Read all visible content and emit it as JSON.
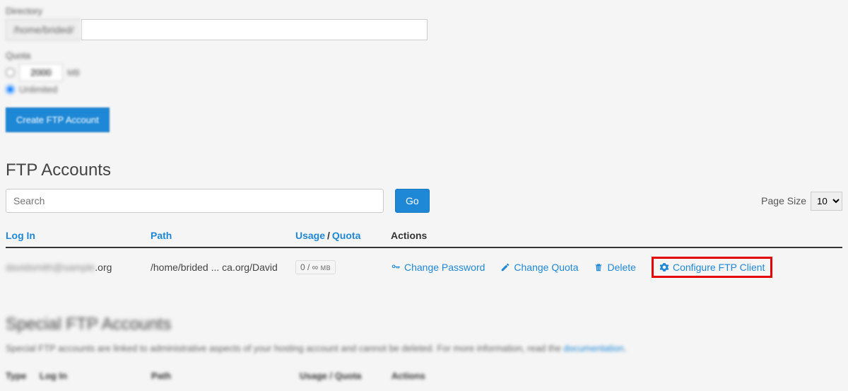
{
  "form": {
    "directory_label": "Directory",
    "directory_prefix": "/home/brided/",
    "quota_label": "Quota",
    "quota_value": "2000",
    "quota_unit": "MB",
    "quota_unlimited": "Unlimited",
    "create_button": "Create FTP Account"
  },
  "ftp_accounts": {
    "title": "FTP Accounts",
    "search_placeholder": "Search",
    "go_button": "Go",
    "page_size_label": "Page Size",
    "page_size_value": "10",
    "headers": {
      "login": "Log In",
      "path": "Path",
      "usage": "Usage",
      "quota": "Quota",
      "actions": "Actions"
    },
    "rows": [
      {
        "login_hidden": "davidsmith@sample",
        "login_visible": ".org",
        "path": "/home/brided ... ca.org/David",
        "usage_text": "0 / ∞",
        "usage_unit": "MB",
        "actions": {
          "change_password": "Change Password",
          "change_quota": "Change Quota",
          "delete": "Delete",
          "configure": "Configure FTP Client"
        }
      }
    ]
  },
  "special": {
    "title": "Special FTP Accounts",
    "description": "Special FTP accounts are linked to administrative aspects of your hosting account and cannot be deleted. For more information, read the ",
    "doc_link": "documentation",
    "headers": {
      "type": "Type",
      "login": "Log In",
      "path": "Path",
      "usage": "Usage / Quota",
      "actions": "Actions"
    }
  }
}
